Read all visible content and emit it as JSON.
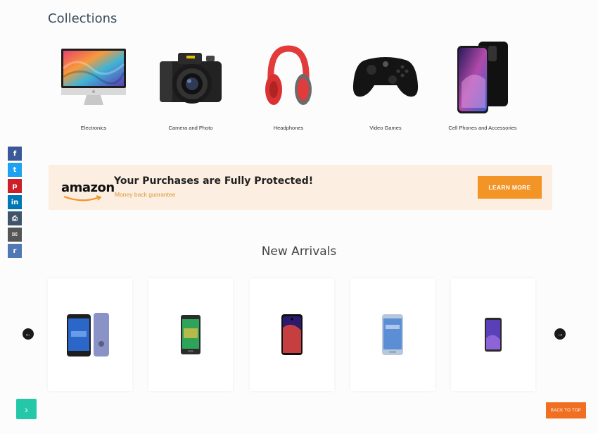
{
  "collections": {
    "title": "Collections",
    "items": [
      {
        "label": "Electronics",
        "icon": "imac-icon"
      },
      {
        "label": "Camera and Photo",
        "icon": "camera-icon"
      },
      {
        "label": "Headphones",
        "icon": "headphones-icon"
      },
      {
        "label": "Video Games",
        "icon": "gamepad-icon"
      },
      {
        "label": "Cell Phones and Accessories",
        "icon": "smartphone-icon"
      }
    ]
  },
  "share": {
    "items": [
      {
        "icon": "facebook-icon",
        "glyph": "f",
        "color": "#3b5998"
      },
      {
        "icon": "twitter-icon",
        "glyph": "t",
        "color": "#1da1f2"
      },
      {
        "icon": "pinterest-icon",
        "glyph": "p",
        "color": "#cb2027"
      },
      {
        "icon": "linkedin-icon",
        "glyph": "in",
        "color": "#0077b5"
      },
      {
        "icon": "print-icon",
        "glyph": "⎙",
        "color": "#40546a"
      },
      {
        "icon": "email-icon",
        "glyph": "✉",
        "color": "#555555"
      },
      {
        "icon": "reddit-icon",
        "glyph": "r",
        "color": "#4f78b5"
      }
    ]
  },
  "banner": {
    "logo": "amazon",
    "title": "Your Purchases are Fully Protected!",
    "subtitle": "Money back guarantee",
    "button": "LEARN MORE"
  },
  "arrivals": {
    "title": "New Arrivals",
    "prev_glyph": "←",
    "next_glyph": "→"
  },
  "footer": {
    "chat_glyph": "›",
    "back_to_top": "BACK TO TOP"
  },
  "colors": {
    "accent_orange": "#f29426",
    "banner_bg": "#fdeee2",
    "chat_green": "#24c8a8",
    "back_top_orange": "#f06f21"
  }
}
